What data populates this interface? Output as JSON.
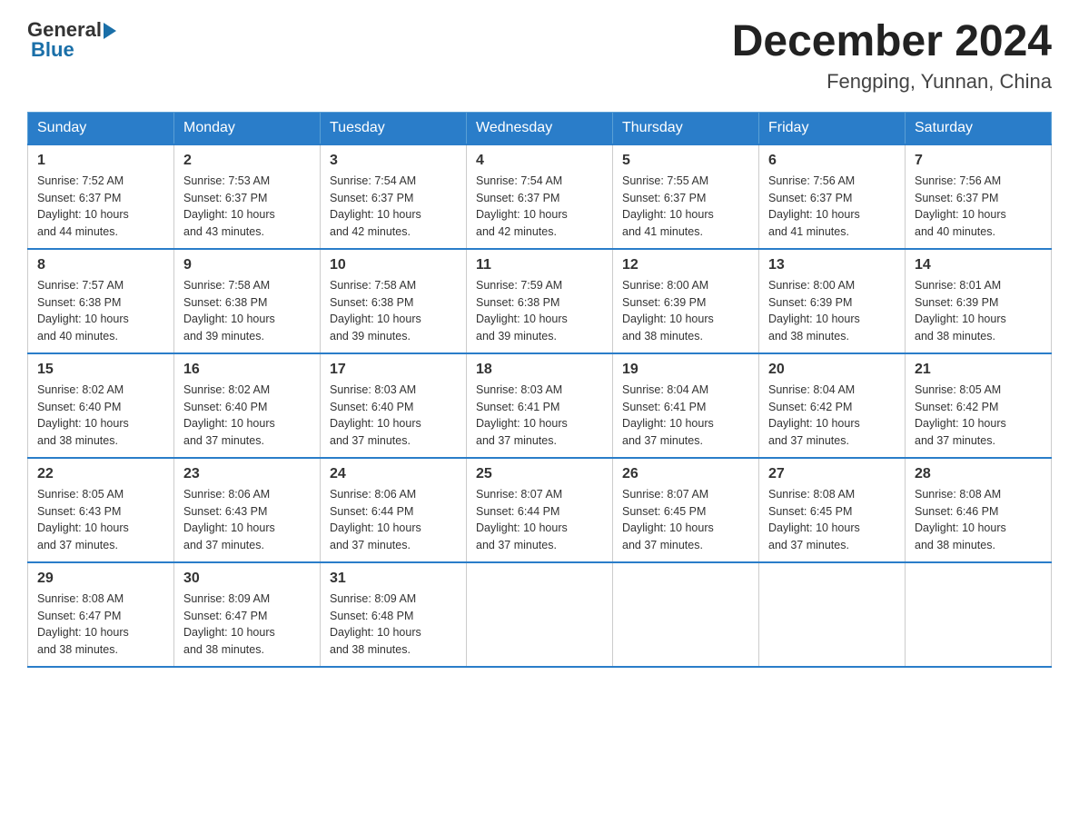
{
  "logo": {
    "general": "General",
    "blue": "Blue"
  },
  "title": {
    "month_year": "December 2024",
    "location": "Fengping, Yunnan, China"
  },
  "days_of_week": [
    "Sunday",
    "Monday",
    "Tuesday",
    "Wednesday",
    "Thursday",
    "Friday",
    "Saturday"
  ],
  "weeks": [
    [
      {
        "day": "1",
        "sunrise": "7:52 AM",
        "sunset": "6:37 PM",
        "daylight": "10 hours and 44 minutes."
      },
      {
        "day": "2",
        "sunrise": "7:53 AM",
        "sunset": "6:37 PM",
        "daylight": "10 hours and 43 minutes."
      },
      {
        "day": "3",
        "sunrise": "7:54 AM",
        "sunset": "6:37 PM",
        "daylight": "10 hours and 42 minutes."
      },
      {
        "day": "4",
        "sunrise": "7:54 AM",
        "sunset": "6:37 PM",
        "daylight": "10 hours and 42 minutes."
      },
      {
        "day": "5",
        "sunrise": "7:55 AM",
        "sunset": "6:37 PM",
        "daylight": "10 hours and 41 minutes."
      },
      {
        "day": "6",
        "sunrise": "7:56 AM",
        "sunset": "6:37 PM",
        "daylight": "10 hours and 41 minutes."
      },
      {
        "day": "7",
        "sunrise": "7:56 AM",
        "sunset": "6:37 PM",
        "daylight": "10 hours and 40 minutes."
      }
    ],
    [
      {
        "day": "8",
        "sunrise": "7:57 AM",
        "sunset": "6:38 PM",
        "daylight": "10 hours and 40 minutes."
      },
      {
        "day": "9",
        "sunrise": "7:58 AM",
        "sunset": "6:38 PM",
        "daylight": "10 hours and 39 minutes."
      },
      {
        "day": "10",
        "sunrise": "7:58 AM",
        "sunset": "6:38 PM",
        "daylight": "10 hours and 39 minutes."
      },
      {
        "day": "11",
        "sunrise": "7:59 AM",
        "sunset": "6:38 PM",
        "daylight": "10 hours and 39 minutes."
      },
      {
        "day": "12",
        "sunrise": "8:00 AM",
        "sunset": "6:39 PM",
        "daylight": "10 hours and 38 minutes."
      },
      {
        "day": "13",
        "sunrise": "8:00 AM",
        "sunset": "6:39 PM",
        "daylight": "10 hours and 38 minutes."
      },
      {
        "day": "14",
        "sunrise": "8:01 AM",
        "sunset": "6:39 PM",
        "daylight": "10 hours and 38 minutes."
      }
    ],
    [
      {
        "day": "15",
        "sunrise": "8:02 AM",
        "sunset": "6:40 PM",
        "daylight": "10 hours and 38 minutes."
      },
      {
        "day": "16",
        "sunrise": "8:02 AM",
        "sunset": "6:40 PM",
        "daylight": "10 hours and 37 minutes."
      },
      {
        "day": "17",
        "sunrise": "8:03 AM",
        "sunset": "6:40 PM",
        "daylight": "10 hours and 37 minutes."
      },
      {
        "day": "18",
        "sunrise": "8:03 AM",
        "sunset": "6:41 PM",
        "daylight": "10 hours and 37 minutes."
      },
      {
        "day": "19",
        "sunrise": "8:04 AM",
        "sunset": "6:41 PM",
        "daylight": "10 hours and 37 minutes."
      },
      {
        "day": "20",
        "sunrise": "8:04 AM",
        "sunset": "6:42 PM",
        "daylight": "10 hours and 37 minutes."
      },
      {
        "day": "21",
        "sunrise": "8:05 AM",
        "sunset": "6:42 PM",
        "daylight": "10 hours and 37 minutes."
      }
    ],
    [
      {
        "day": "22",
        "sunrise": "8:05 AM",
        "sunset": "6:43 PM",
        "daylight": "10 hours and 37 minutes."
      },
      {
        "day": "23",
        "sunrise": "8:06 AM",
        "sunset": "6:43 PM",
        "daylight": "10 hours and 37 minutes."
      },
      {
        "day": "24",
        "sunrise": "8:06 AM",
        "sunset": "6:44 PM",
        "daylight": "10 hours and 37 minutes."
      },
      {
        "day": "25",
        "sunrise": "8:07 AM",
        "sunset": "6:44 PM",
        "daylight": "10 hours and 37 minutes."
      },
      {
        "day": "26",
        "sunrise": "8:07 AM",
        "sunset": "6:45 PM",
        "daylight": "10 hours and 37 minutes."
      },
      {
        "day": "27",
        "sunrise": "8:08 AM",
        "sunset": "6:45 PM",
        "daylight": "10 hours and 37 minutes."
      },
      {
        "day": "28",
        "sunrise": "8:08 AM",
        "sunset": "6:46 PM",
        "daylight": "10 hours and 38 minutes."
      }
    ],
    [
      {
        "day": "29",
        "sunrise": "8:08 AM",
        "sunset": "6:47 PM",
        "daylight": "10 hours and 38 minutes."
      },
      {
        "day": "30",
        "sunrise": "8:09 AM",
        "sunset": "6:47 PM",
        "daylight": "10 hours and 38 minutes."
      },
      {
        "day": "31",
        "sunrise": "8:09 AM",
        "sunset": "6:48 PM",
        "daylight": "10 hours and 38 minutes."
      },
      null,
      null,
      null,
      null
    ]
  ],
  "labels": {
    "sunrise": "Sunrise:",
    "sunset": "Sunset:",
    "daylight": "Daylight:"
  }
}
